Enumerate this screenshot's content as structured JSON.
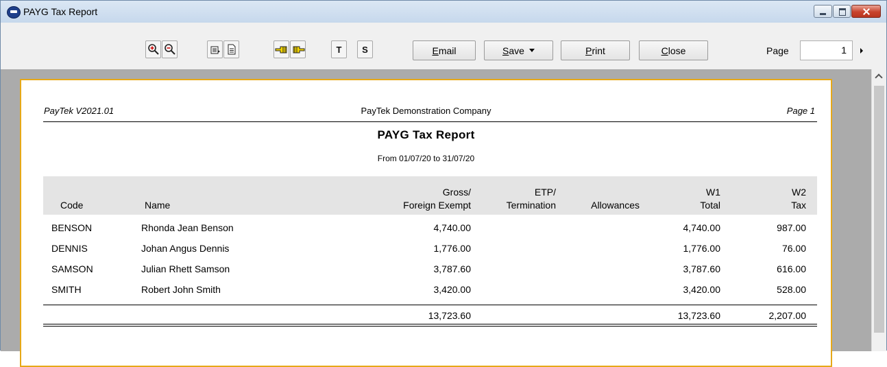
{
  "window": {
    "title": "PAYG Tax Report",
    "app_icon": "paytek-icon",
    "controls": [
      "minimize-icon",
      "maximize-icon",
      "close-icon"
    ]
  },
  "toolbar": {
    "tools": [
      {
        "name": "zoom-in-icon"
      },
      {
        "name": "zoom-out-icon"
      },
      {
        "name": "page-view-icon"
      },
      {
        "name": "document-icon"
      },
      {
        "name": "point-left-icon"
      },
      {
        "name": "point-right-icon"
      },
      {
        "name": "t-button",
        "label": "T"
      },
      {
        "name": "s-button",
        "label": "S"
      }
    ],
    "email_label": "Email",
    "save_label": "Save",
    "print_label": "Print",
    "close_label": "Close",
    "page_label": "Page",
    "page_value": "1"
  },
  "report": {
    "version": "PayTek V2021.01",
    "company": "PayTek Demonstration Company",
    "page": "Page 1",
    "title": "PAYG Tax Report",
    "range": "From 01/07/20 to 31/07/20",
    "columns": [
      {
        "line1": "",
        "line2": "Code"
      },
      {
        "line1": "",
        "line2": "Name"
      },
      {
        "line1": "Gross/",
        "line2": "Foreign Exempt"
      },
      {
        "line1": "ETP/",
        "line2": "Termination"
      },
      {
        "line1": "",
        "line2": "Allowances"
      },
      {
        "line1": "W1",
        "line2": "Total"
      },
      {
        "line1": "W2",
        "line2": "Tax"
      }
    ],
    "rows": [
      {
        "code": "BENSON",
        "name": "Rhonda Jean Benson",
        "gross": "4,740.00",
        "etp": "",
        "allowances": "",
        "w1": "4,740.00",
        "w2": "987.00"
      },
      {
        "code": "DENNIS",
        "name": "Johan Angus Dennis",
        "gross": "1,776.00",
        "etp": "",
        "allowances": "",
        "w1": "1,776.00",
        "w2": "76.00"
      },
      {
        "code": "SAMSON",
        "name": "Julian Rhett Samson",
        "gross": "3,787.60",
        "etp": "",
        "allowances": "",
        "w1": "3,787.60",
        "w2": "616.00"
      },
      {
        "code": "SMITH",
        "name": "Robert John Smith",
        "gross": "3,420.00",
        "etp": "",
        "allowances": "",
        "w1": "3,420.00",
        "w2": "528.00"
      }
    ],
    "totals": {
      "gross": "13,723.60",
      "w1": "13,723.60",
      "w2": "2,207.00"
    }
  },
  "colors": {
    "paper_border": "#e6a817",
    "header_shade": "#e4e4e4",
    "canvas": "#ababab",
    "titlebar": "#c6d8ec",
    "close_button": "#c8432c"
  }
}
